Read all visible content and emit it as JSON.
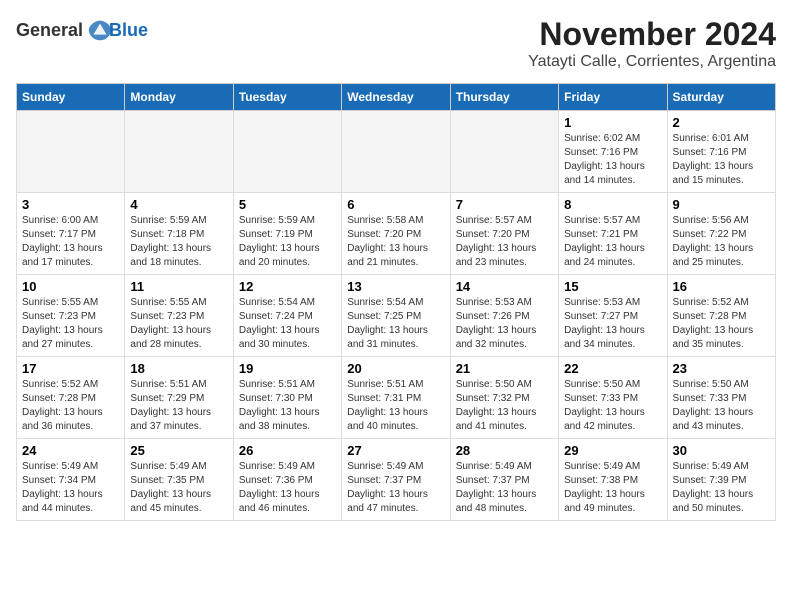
{
  "header": {
    "logo_general": "General",
    "logo_blue": "Blue",
    "month_title": "November 2024",
    "location": "Yatayti Calle, Corrientes, Argentina"
  },
  "weekdays": [
    "Sunday",
    "Monday",
    "Tuesday",
    "Wednesday",
    "Thursday",
    "Friday",
    "Saturday"
  ],
  "weeks": [
    [
      {
        "day": "",
        "info": ""
      },
      {
        "day": "",
        "info": ""
      },
      {
        "day": "",
        "info": ""
      },
      {
        "day": "",
        "info": ""
      },
      {
        "day": "",
        "info": ""
      },
      {
        "day": "1",
        "info": "Sunrise: 6:02 AM\nSunset: 7:16 PM\nDaylight: 13 hours and 14 minutes."
      },
      {
        "day": "2",
        "info": "Sunrise: 6:01 AM\nSunset: 7:16 PM\nDaylight: 13 hours and 15 minutes."
      }
    ],
    [
      {
        "day": "3",
        "info": "Sunrise: 6:00 AM\nSunset: 7:17 PM\nDaylight: 13 hours and 17 minutes."
      },
      {
        "day": "4",
        "info": "Sunrise: 5:59 AM\nSunset: 7:18 PM\nDaylight: 13 hours and 18 minutes."
      },
      {
        "day": "5",
        "info": "Sunrise: 5:59 AM\nSunset: 7:19 PM\nDaylight: 13 hours and 20 minutes."
      },
      {
        "day": "6",
        "info": "Sunrise: 5:58 AM\nSunset: 7:20 PM\nDaylight: 13 hours and 21 minutes."
      },
      {
        "day": "7",
        "info": "Sunrise: 5:57 AM\nSunset: 7:20 PM\nDaylight: 13 hours and 23 minutes."
      },
      {
        "day": "8",
        "info": "Sunrise: 5:57 AM\nSunset: 7:21 PM\nDaylight: 13 hours and 24 minutes."
      },
      {
        "day": "9",
        "info": "Sunrise: 5:56 AM\nSunset: 7:22 PM\nDaylight: 13 hours and 25 minutes."
      }
    ],
    [
      {
        "day": "10",
        "info": "Sunrise: 5:55 AM\nSunset: 7:23 PM\nDaylight: 13 hours and 27 minutes."
      },
      {
        "day": "11",
        "info": "Sunrise: 5:55 AM\nSunset: 7:23 PM\nDaylight: 13 hours and 28 minutes."
      },
      {
        "day": "12",
        "info": "Sunrise: 5:54 AM\nSunset: 7:24 PM\nDaylight: 13 hours and 30 minutes."
      },
      {
        "day": "13",
        "info": "Sunrise: 5:54 AM\nSunset: 7:25 PM\nDaylight: 13 hours and 31 minutes."
      },
      {
        "day": "14",
        "info": "Sunrise: 5:53 AM\nSunset: 7:26 PM\nDaylight: 13 hours and 32 minutes."
      },
      {
        "day": "15",
        "info": "Sunrise: 5:53 AM\nSunset: 7:27 PM\nDaylight: 13 hours and 34 minutes."
      },
      {
        "day": "16",
        "info": "Sunrise: 5:52 AM\nSunset: 7:28 PM\nDaylight: 13 hours and 35 minutes."
      }
    ],
    [
      {
        "day": "17",
        "info": "Sunrise: 5:52 AM\nSunset: 7:28 PM\nDaylight: 13 hours and 36 minutes."
      },
      {
        "day": "18",
        "info": "Sunrise: 5:51 AM\nSunset: 7:29 PM\nDaylight: 13 hours and 37 minutes."
      },
      {
        "day": "19",
        "info": "Sunrise: 5:51 AM\nSunset: 7:30 PM\nDaylight: 13 hours and 38 minutes."
      },
      {
        "day": "20",
        "info": "Sunrise: 5:51 AM\nSunset: 7:31 PM\nDaylight: 13 hours and 40 minutes."
      },
      {
        "day": "21",
        "info": "Sunrise: 5:50 AM\nSunset: 7:32 PM\nDaylight: 13 hours and 41 minutes."
      },
      {
        "day": "22",
        "info": "Sunrise: 5:50 AM\nSunset: 7:33 PM\nDaylight: 13 hours and 42 minutes."
      },
      {
        "day": "23",
        "info": "Sunrise: 5:50 AM\nSunset: 7:33 PM\nDaylight: 13 hours and 43 minutes."
      }
    ],
    [
      {
        "day": "24",
        "info": "Sunrise: 5:49 AM\nSunset: 7:34 PM\nDaylight: 13 hours and 44 minutes."
      },
      {
        "day": "25",
        "info": "Sunrise: 5:49 AM\nSunset: 7:35 PM\nDaylight: 13 hours and 45 minutes."
      },
      {
        "day": "26",
        "info": "Sunrise: 5:49 AM\nSunset: 7:36 PM\nDaylight: 13 hours and 46 minutes."
      },
      {
        "day": "27",
        "info": "Sunrise: 5:49 AM\nSunset: 7:37 PM\nDaylight: 13 hours and 47 minutes."
      },
      {
        "day": "28",
        "info": "Sunrise: 5:49 AM\nSunset: 7:37 PM\nDaylight: 13 hours and 48 minutes."
      },
      {
        "day": "29",
        "info": "Sunrise: 5:49 AM\nSunset: 7:38 PM\nDaylight: 13 hours and 49 minutes."
      },
      {
        "day": "30",
        "info": "Sunrise: 5:49 AM\nSunset: 7:39 PM\nDaylight: 13 hours and 50 minutes."
      }
    ]
  ]
}
